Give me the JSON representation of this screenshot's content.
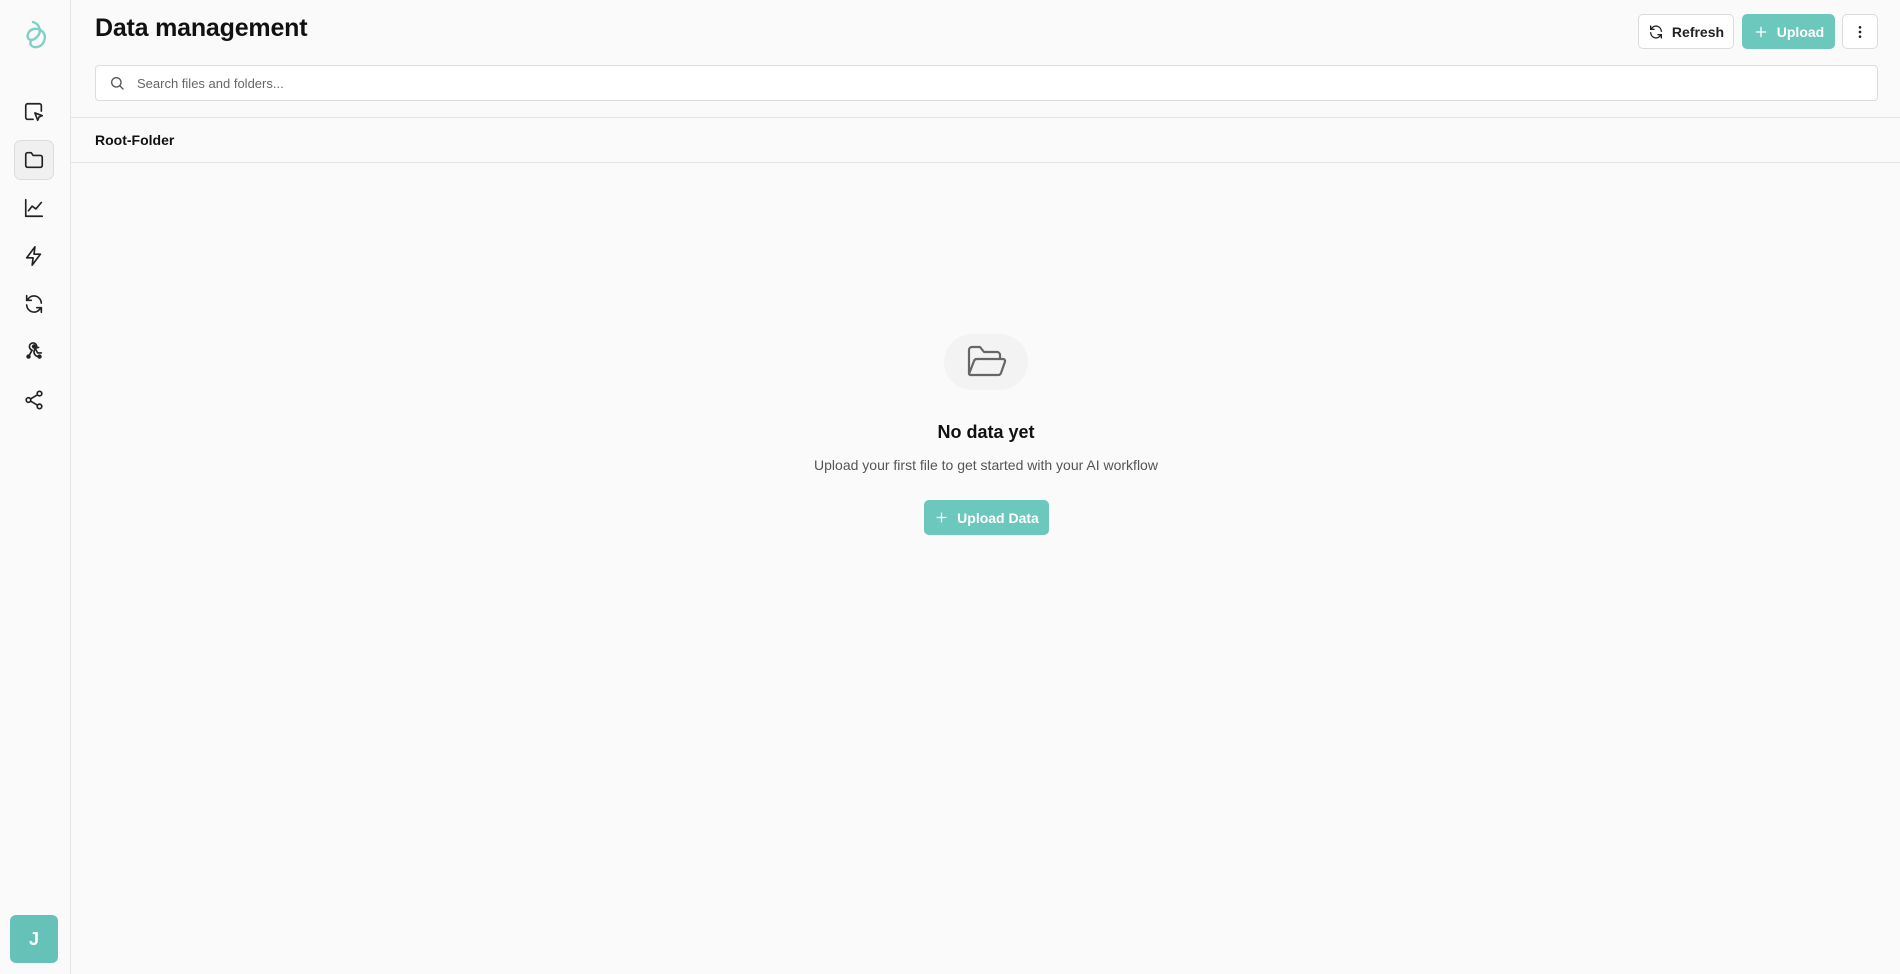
{
  "header": {
    "title": "Data management",
    "refresh_label": "Refresh",
    "upload_label": "Upload"
  },
  "search": {
    "placeholder": "Search files and folders..."
  },
  "breadcrumb": {
    "items": [
      "Root-Folder"
    ]
  },
  "sidebar": {
    "items": [
      {
        "icon": "cursor-select-icon"
      },
      {
        "icon": "folder-icon",
        "active": true
      },
      {
        "icon": "line-chart-icon"
      },
      {
        "icon": "lightning-icon"
      },
      {
        "icon": "refresh-icon"
      },
      {
        "icon": "webhook-icon"
      },
      {
        "icon": "share-icon"
      }
    ],
    "avatar_initial": "J"
  },
  "empty_state": {
    "icon": "folder-open-icon",
    "title": "No data yet",
    "subtitle": "Upload your first file to get started with your AI workflow",
    "button_label": "Upload Data"
  },
  "colors": {
    "accent": "#6cc7bd",
    "logo": "#7fd1c7",
    "background": "#fafafa"
  }
}
